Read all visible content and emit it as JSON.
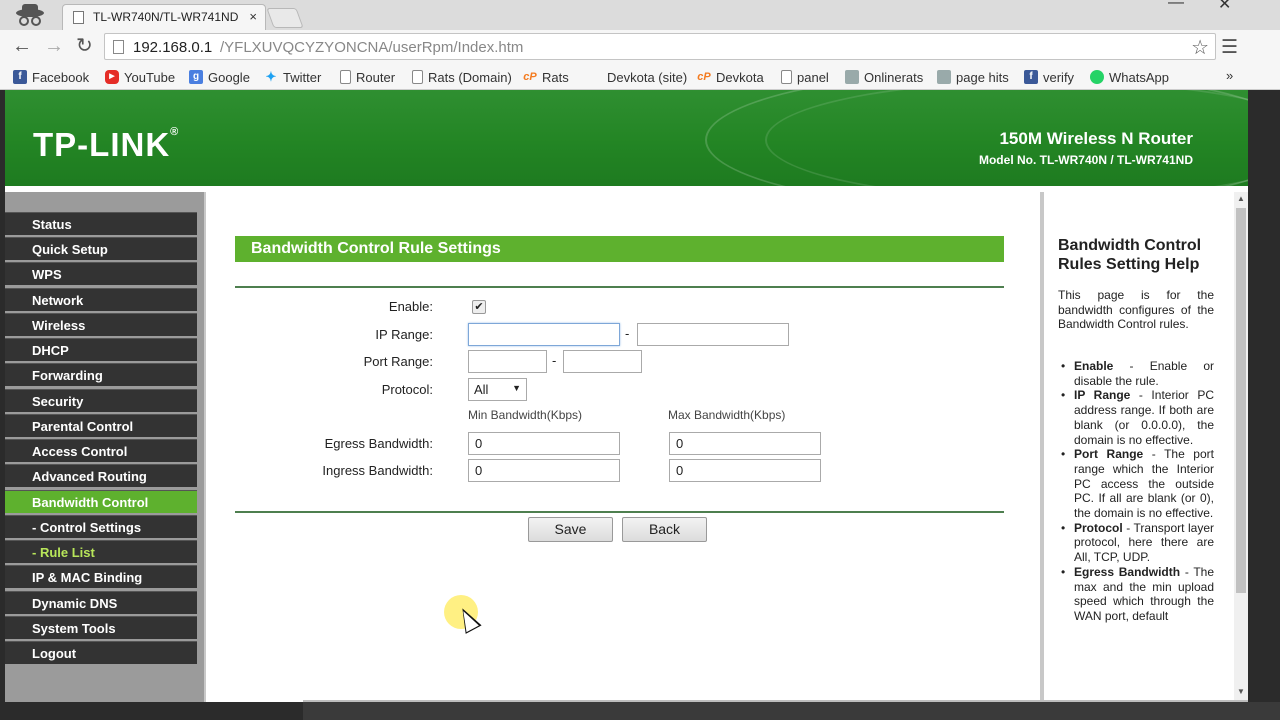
{
  "browser": {
    "tab_title": "TL-WR740N/TL-WR741ND",
    "tab_close": "×",
    "url_host": "192.168.0.1",
    "url_path": "/YFLXUVQCYZYONCNA/userRpm/Index.htm",
    "bookmarks": [
      {
        "label": "Facebook",
        "icon": "facebook-icon"
      },
      {
        "label": "YouTube",
        "icon": "youtube-icon"
      },
      {
        "label": "Google",
        "icon": "google-icon"
      },
      {
        "label": "Twitter",
        "icon": "twitter-icon"
      },
      {
        "label": "Router",
        "icon": "page-icon"
      },
      {
        "label": "Rats (Domain)",
        "icon": "page-icon"
      },
      {
        "label": "Rats",
        "icon": "cpanel-icon"
      },
      {
        "label": "Devkota (site)",
        "icon": "none"
      },
      {
        "label": "Devkota",
        "icon": "cpanel-icon"
      },
      {
        "label": "panel",
        "icon": "page-icon"
      },
      {
        "label": "Onlinerats",
        "icon": "image-icon"
      },
      {
        "label": "page hits",
        "icon": "image-icon"
      },
      {
        "label": "verify",
        "icon": "facebook-icon"
      },
      {
        "label": "WhatsApp",
        "icon": "whatsapp-icon"
      }
    ],
    "bookmarks_more": "»"
  },
  "banner": {
    "logo": "TP-LINK",
    "product_name": "150M Wireless N Router",
    "model_no": "Model No. TL-WR740N / TL-WR741ND"
  },
  "menu": {
    "items": [
      {
        "label": "Status"
      },
      {
        "label": "Quick Setup"
      },
      {
        "label": "WPS"
      },
      {
        "label": "Network"
      },
      {
        "label": "Wireless"
      },
      {
        "label": "DHCP"
      },
      {
        "label": "Forwarding"
      },
      {
        "label": "Security"
      },
      {
        "label": "Parental Control"
      },
      {
        "label": "Access Control"
      },
      {
        "label": "Advanced Routing"
      },
      {
        "label": "Bandwidth Control"
      },
      {
        "label": "- Control Settings"
      },
      {
        "label": "- Rule List"
      },
      {
        "label": "IP & MAC Binding"
      },
      {
        "label": "Dynamic DNS"
      },
      {
        "label": "System Tools"
      },
      {
        "label": "Logout"
      }
    ],
    "active": "Bandwidth Control",
    "active_sub": "- Rule List"
  },
  "form": {
    "title": "Bandwidth Control Rule Settings",
    "enable_label": "Enable:",
    "enable_checked": true,
    "enable_mark": "✔",
    "ip_range_label": "IP Range:",
    "ip_start": "",
    "ip_end": "",
    "port_range_label": "Port Range:",
    "port_start": "",
    "port_end": "",
    "range_sep": "-",
    "protocol_label": "Protocol:",
    "protocol_value": "All",
    "protocol_caret": "▼",
    "min_bw_header": "Min Bandwidth(Kbps)",
    "max_bw_header": "Max Bandwidth(Kbps)",
    "egress_label": "Egress Bandwidth:",
    "egress_min": "0",
    "egress_max": "0",
    "ingress_label": "Ingress Bandwidth:",
    "ingress_min": "0",
    "ingress_max": "0",
    "save_label": "Save",
    "back_label": "Back"
  },
  "help": {
    "title": "Bandwidth Control Rules Setting Help",
    "intro": "This page is for the bandwidth configures of the Bandwidth Control rules.",
    "items": [
      {
        "term": "Enable",
        "text": " - Enable or disable the rule."
      },
      {
        "term": "IP Range",
        "text": " - Interior PC address range. If both are blank (or 0.0.0.0), the domain is no effective."
      },
      {
        "term": "Port Range",
        "text": " - The port range which the Interior PC access the outside PC. If all are blank (or 0), the domain is no effective."
      },
      {
        "term": "Protocol",
        "text": " - Transport layer protocol, here there are All, TCP, UDP."
      },
      {
        "term": "Egress Bandwidth",
        "text": " - The max and the min upload speed which through the WAN port, default"
      }
    ]
  }
}
